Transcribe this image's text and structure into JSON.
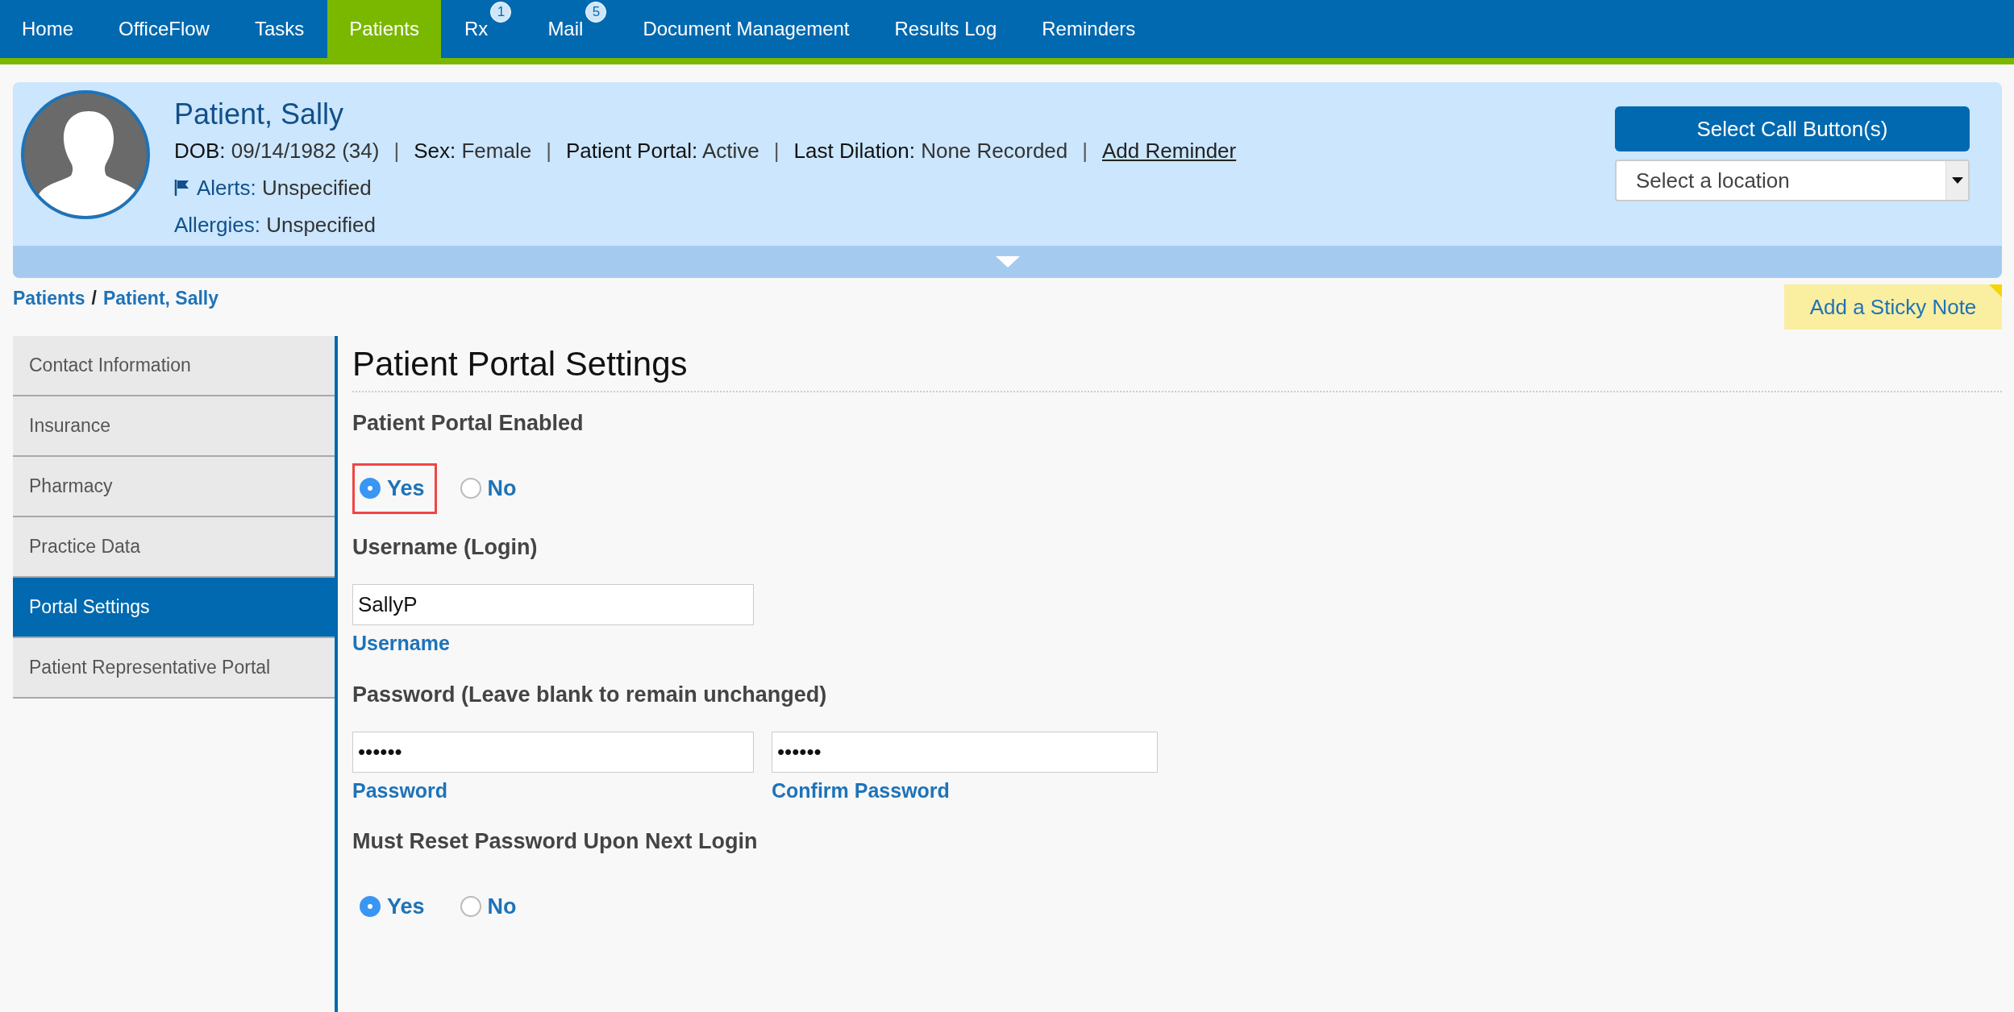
{
  "nav": [
    {
      "label": "Home",
      "selected": false
    },
    {
      "label": "OfficeFlow",
      "selected": false
    },
    {
      "label": "Tasks",
      "selected": false
    },
    {
      "label": "Patients",
      "selected": true
    },
    {
      "label": "Rx",
      "selected": false,
      "badge": "1"
    },
    {
      "label": "Mail",
      "selected": false,
      "badge": "5"
    },
    {
      "label": "Document Management",
      "selected": false
    },
    {
      "label": "Results Log",
      "selected": false
    },
    {
      "label": "Reminders",
      "selected": false
    }
  ],
  "patient": {
    "name": "Patient, Sally",
    "separator": "|",
    "fields": [
      {
        "label": "DOB:",
        "value": "09/14/1982 (34)"
      },
      {
        "label": "Sex:",
        "value": "Female"
      },
      {
        "label": "Patient Portal:",
        "value": "Active"
      },
      {
        "label": "Last Dilation:",
        "value": "None Recorded"
      }
    ],
    "add_reminder": "Add Reminder",
    "alerts": {
      "label": "Alerts:",
      "value": "Unspecified"
    },
    "allergies": {
      "label": "Allergies:",
      "value": "Unspecified"
    },
    "call_button": "Select Call Button(s)",
    "location_select": {
      "value": "Select a location"
    }
  },
  "breadcrumb": {
    "items": [
      "Patients",
      "Patient, Sally"
    ],
    "separator": "/"
  },
  "sticky_note": "Add a Sticky Note",
  "sidebar": {
    "items": [
      {
        "label": "Contact Information",
        "selected": false
      },
      {
        "label": "Insurance",
        "selected": false
      },
      {
        "label": "Pharmacy",
        "selected": false
      },
      {
        "label": "Practice Data",
        "selected": false
      },
      {
        "label": "Portal Settings",
        "selected": true
      },
      {
        "label": "Patient Representative Portal",
        "selected": false
      }
    ]
  },
  "main": {
    "title": "Patient Portal Settings",
    "sections": [
      {
        "kind": "radio",
        "heading": "Patient Portal Enabled",
        "options": [
          {
            "label": "Yes",
            "selected": true,
            "highlighted": true
          },
          {
            "label": "No",
            "selected": false,
            "highlighted": false
          }
        ]
      },
      {
        "kind": "fields",
        "heading": "Username (Login)",
        "fields": [
          {
            "value": "SallyP",
            "label": "Username"
          }
        ]
      },
      {
        "kind": "fields",
        "heading": "Password (Leave blank to remain unchanged)",
        "fields": [
          {
            "value": "••••••",
            "label": "Password"
          },
          {
            "value": "••••••",
            "label": "Confirm Password"
          }
        ]
      },
      {
        "kind": "radio",
        "heading": "Must Reset Password Upon Next Login",
        "options": [
          {
            "label": "Yes",
            "selected": true,
            "highlighted": false
          },
          {
            "label": "No",
            "selected": false,
            "highlighted": false
          }
        ]
      }
    ]
  }
}
